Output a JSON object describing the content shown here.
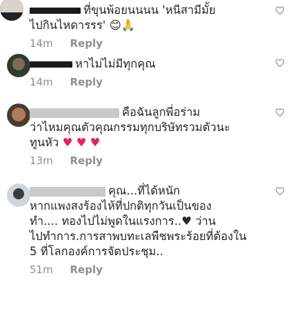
{
  "comments": [
    {
      "text_lines": [
        "ที่ขุนพ้อยนนนน 'หนีสามีมั้ย",
        "ไปกินไหดารรร' "
      ],
      "emoji": "😊🙏",
      "time": "14m",
      "reply_label": "Reply"
    },
    {
      "text_lines": [
        "หาไม่ไม่มีทุกคุณ"
      ],
      "emoji": "",
      "time": "14m",
      "reply_label": "Reply"
    },
    {
      "text_lines": [
        "คือฉันลูกพี่อร่าม",
        "ว่าไหมคุณตัวคุณกรรมทุกบริษัทรวมตัวนะ",
        "ทูนหัว"
      ],
      "emoji": "♥ ♥ ♥",
      "time": "13m",
      "reply_label": "Reply"
    },
    {
      "text_lines": [
        "คุณ...ที่ได้หนัก",
        "หากแพงสงร้องไห้ที่ปกติทุกวันเป็นของ",
        "ทำ.... ทองไปไม่พูดในแรงการ..♥ ว่าน",
        "ไปทำการ.การสาพบทะเลพืชพระร้อยที่ต้องใน",
        "5 ที่โลกองค์การจัดประชุม.."
      ],
      "emoji": "",
      "time": "51m",
      "reply_label": "Reply"
    }
  ]
}
